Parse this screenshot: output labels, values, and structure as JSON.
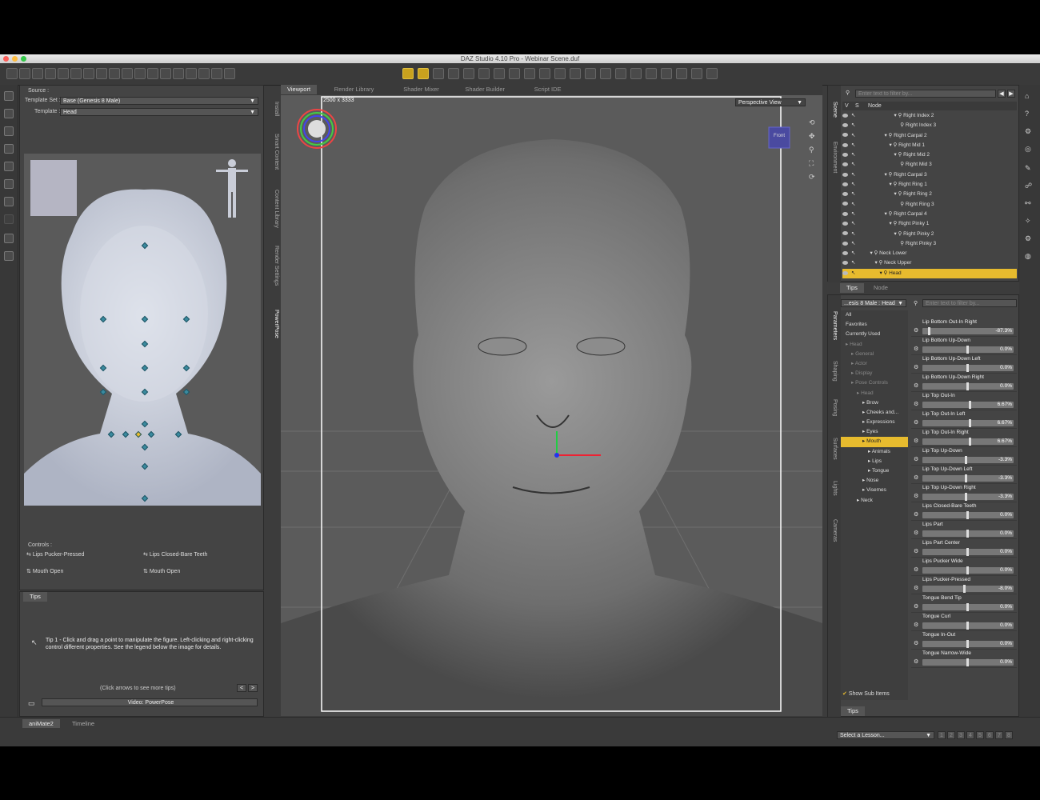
{
  "window": {
    "title": "DAZ Studio 4.10 Pro - Webinar Scene.duf"
  },
  "left_panel": {
    "source_label": "Source :",
    "template_set_label": "Template Set :",
    "template_set_value": "Base (Genesis 8 Male)",
    "template_label": "Template :",
    "template_value": "Head",
    "controls_label": "Controls :",
    "controls": [
      "Lips Pucker-Pressed",
      "Lips Closed-Bare Teeth",
      "Mouth Open",
      "Mouth Open"
    ],
    "vertical_tabs": [
      "Install",
      "Smart Content",
      "Content Library",
      "Render Settings",
      "PowerPose"
    ]
  },
  "tips_panel": {
    "tab": "Tips",
    "tip_text": "Tip 1 - Click and drag a point to manipulate the figure. Left-clicking and right-clicking control different properties. See the legend below the image for details.",
    "nav_hint": "(Click arrows to see more tips)",
    "prev": "<",
    "next": ">",
    "video_button": "Video: PowerPose"
  },
  "viewport_tabs": [
    "Viewport",
    "Render Library",
    "Shader Mixer",
    "Shader Builder",
    "Script IDE"
  ],
  "viewport": {
    "resolution": "2500 x 3333",
    "view_select": "Perspective View",
    "cube_label": "Front"
  },
  "scene": {
    "filter_placeholder": "Enter text to filter by...",
    "col_v": "V",
    "col_s": "S",
    "col_node": "Node",
    "vertical_tabs": [
      "Scene",
      "Environment"
    ],
    "nodes": [
      {
        "label": "Right Index 2",
        "indent": 8
      },
      {
        "label": "Right Index 3",
        "indent": 9
      },
      {
        "label": "Right Carpal 2",
        "indent": 6
      },
      {
        "label": "Right Mid 1",
        "indent": 7
      },
      {
        "label": "Right Mid 2",
        "indent": 8
      },
      {
        "label": "Right Mid 3",
        "indent": 9
      },
      {
        "label": "Right Carpal 3",
        "indent": 6
      },
      {
        "label": "Right Ring 1",
        "indent": 7
      },
      {
        "label": "Right Ring 2",
        "indent": 8
      },
      {
        "label": "Right Ring 3",
        "indent": 9
      },
      {
        "label": "Right Carpal 4",
        "indent": 6
      },
      {
        "label": "Right Pinky 1",
        "indent": 7
      },
      {
        "label": "Right Pinky 2",
        "indent": 8
      },
      {
        "label": "Right Pinky 3",
        "indent": 9
      },
      {
        "label": "Neck Lower",
        "indent": 3
      },
      {
        "label": "Neck Upper",
        "indent": 4
      },
      {
        "label": "Head",
        "indent": 5
      }
    ],
    "bottom_tabs": [
      "Tips",
      "Node"
    ]
  },
  "parameters": {
    "figure_select": "...esis 8 Male : Head",
    "filter_placeholder": "Enter text to filter by...",
    "vertical_tabs": [
      "Parameters",
      "Shaping",
      "Posing",
      "Surfaces",
      "Lights",
      "Cameras"
    ],
    "categories": [
      {
        "label": "All",
        "indent": 0
      },
      {
        "label": "Favorites",
        "indent": 0
      },
      {
        "label": "Currently Used",
        "indent": 0
      },
      {
        "label": "Head",
        "indent": 0,
        "dim": true
      },
      {
        "label": "General",
        "indent": 1,
        "dim": true
      },
      {
        "label": "Actor",
        "indent": 1,
        "dim": true
      },
      {
        "label": "Display",
        "indent": 1,
        "dim": true
      },
      {
        "label": "Pose Controls",
        "indent": 1,
        "dim": true
      },
      {
        "label": "Head",
        "indent": 2,
        "dim": true
      },
      {
        "label": "Brow",
        "indent": 3
      },
      {
        "label": "Cheeks and...",
        "indent": 3
      },
      {
        "label": "Expressions",
        "indent": 3
      },
      {
        "label": "Eyes",
        "indent": 3
      },
      {
        "label": "Mouth",
        "indent": 3,
        "sel": true
      },
      {
        "label": "Animals",
        "indent": 4
      },
      {
        "label": "Lips",
        "indent": 4
      },
      {
        "label": "Tongue",
        "indent": 4
      },
      {
        "label": "Nose",
        "indent": 3
      },
      {
        "label": "Visemes",
        "indent": 3
      },
      {
        "label": "Neck",
        "indent": 2
      }
    ],
    "show_sub_items": "Show Sub Items",
    "sliders": [
      {
        "name": "Lip Bottom Out-In Right",
        "value": "-87.3%",
        "level": 0.06
      },
      {
        "name": "Lip Bottom Up-Down",
        "value": "0.0%",
        "level": 0.5
      },
      {
        "name": "Lip Bottom Up-Down Left",
        "value": "0.0%",
        "level": 0.5
      },
      {
        "name": "Lip Bottom Up-Down Right",
        "value": "0.0%",
        "level": 0.5
      },
      {
        "name": "Lip Top Out-In",
        "value": "6.67%",
        "level": 0.53
      },
      {
        "name": "Lip Top Out-In Left",
        "value": "6.67%",
        "level": 0.53
      },
      {
        "name": "Lip Top Out-In Right",
        "value": "6.67%",
        "level": 0.53
      },
      {
        "name": "Lip Top Up-Down",
        "value": "-3.3%",
        "level": 0.48
      },
      {
        "name": "Lip Top Up-Down Left",
        "value": "-3.3%",
        "level": 0.48
      },
      {
        "name": "Lip Top Up-Down Right",
        "value": "-3.3%",
        "level": 0.48
      },
      {
        "name": "Lips Closed-Bare Teeth",
        "value": "0.0%",
        "level": 0.5
      },
      {
        "name": "Lips Part",
        "value": "0.0%",
        "level": 0.5
      },
      {
        "name": "Lips Part Center",
        "value": "0.0%",
        "level": 0.5
      },
      {
        "name": "Lips Pucker Wide",
        "value": "0.0%",
        "level": 0.5
      },
      {
        "name": "Lips Pucker-Pressed",
        "value": "-8.0%",
        "level": 0.46
      },
      {
        "name": "Tongue Bend Tip",
        "value": "0.0%",
        "level": 0.5
      },
      {
        "name": "Tongue Curl",
        "value": "0.0%",
        "level": 0.5
      },
      {
        "name": "Tongue In-Out",
        "value": "0.0%",
        "level": 0.5
      },
      {
        "name": "Tongue Narrow-Wide",
        "value": "0.0%",
        "level": 0.5
      }
    ],
    "bottom_tab": "Tips"
  },
  "bottom": {
    "tabs": [
      "aniMate2",
      "Timeline"
    ],
    "lesson_select": "Select a Lesson...",
    "pages": [
      "1",
      "2",
      "3",
      "4",
      "5",
      "6",
      "7",
      "8"
    ]
  },
  "colors": {
    "accent": "#e7bb2e",
    "control_point": "#3a8a9e"
  }
}
